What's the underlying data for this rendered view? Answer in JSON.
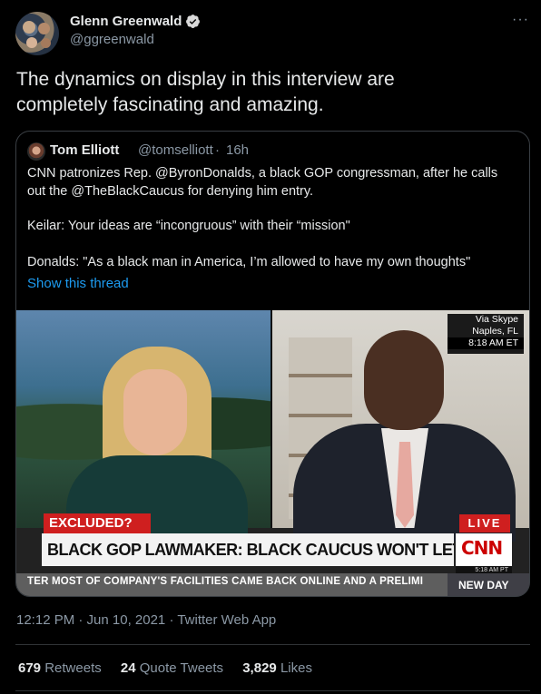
{
  "author": {
    "name": "Glenn Greenwald",
    "handle": "@ggreenwald",
    "verified_icon": "verified-badge-icon"
  },
  "more_icon": "···",
  "tweet_text": [
    "The dynamics on display in this interview are",
    "completely fascinating and amazing."
  ],
  "quote": {
    "name": "Tom Elliott",
    "handle": "@tomselliott",
    "separator": "·",
    "time": "16h",
    "lines": [
      "CNN patronizes Rep. @ByronDonalds, a black GOP congressman, after he calls",
      "out the @TheBlackCaucus for denying him entry.",
      "Keilar: Your ideas are “incongruous” with their “mission\"",
      "Donalds: \"As a black man in America, I’m allowed to have my own thoughts\""
    ],
    "show_thread": "Show this thread",
    "video": {
      "skype_lines": [
        "Via Skype",
        "Naples, FL",
        "8:18 AM ET"
      ],
      "excluded": "EXCLUDED?",
      "live": "LIVE",
      "headline": "BLACK GOP LAWMAKER: BLACK CAUCUS WON'T LET ME INTO GROUP",
      "logo": "CNN",
      "logo_time": "5:18 AM PT",
      "ticker": "TER MOST OF COMPANY'S FACILITIES CAME BACK ONLINE AND A PRELIMI",
      "new_day": "NEW DAY"
    }
  },
  "meta": "12:12 PM · Jun 10, 2021 · Twitter Web App",
  "stats": {
    "retweets_count": "679",
    "retweets_label": "Retweets",
    "quotes_count": "24",
    "quotes_label": "Quote Tweets",
    "likes_count": "3,829",
    "likes_label": "Likes"
  },
  "colors": {
    "background": "#000000",
    "link": "#1d9bf0",
    "secondary_text": "#8b98a5",
    "cnn_red": "#cc0000"
  }
}
